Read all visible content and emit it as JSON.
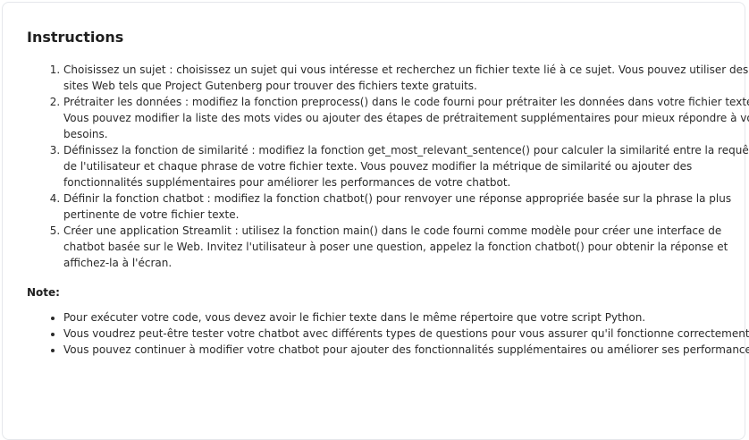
{
  "title": "Instructions",
  "steps": [
    "Choisissez un sujet : choisissez un sujet qui vous intéresse et recherchez un fichier texte lié à ce sujet. Vous pouvez utiliser des sites Web tels que Project Gutenberg pour trouver des fichiers texte gratuits.",
    "Prétraiter les données : modifiez la fonction preprocess() dans le code fourni pour prétraiter les données dans votre fichier texte. Vous pouvez modifier la liste des mots vides ou ajouter des étapes de prétraitement supplémentaires pour mieux répondre à vos besoins.",
    "Définissez la fonction de similarité : modifiez la fonction get_most_relevant_sentence() pour calculer la similarité entre la requête de l'utilisateur et chaque phrase de votre fichier texte. Vous pouvez modifier la métrique de similarité ou ajouter des fonctionnalités supplémentaires pour améliorer les performances de votre chatbot.",
    "Définir la fonction chatbot : modifiez la fonction chatbot() pour renvoyer une réponse appropriée basée sur la phrase la plus pertinente de votre fichier texte.",
    "Créer une application Streamlit : utilisez la fonction main() dans le code fourni comme modèle pour créer une interface de chatbot basée sur le Web. Invitez l'utilisateur à poser une question, appelez la fonction chatbot() pour obtenir la réponse et affichez-la à l'écran."
  ],
  "note_label": "Note:",
  "notes": [
    "Pour exécuter votre code, vous devez avoir le fichier texte dans le même répertoire que votre script Python.",
    "Vous voudrez peut-être tester votre chatbot avec différents types de questions pour vous assurer qu'il fonctionne correctement.",
    "Vous pouvez continuer à modifier votre chatbot pour ajouter des fonctionnalités supplémentaires ou améliorer ses performances."
  ]
}
